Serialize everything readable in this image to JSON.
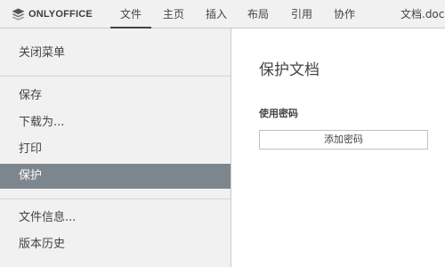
{
  "app": {
    "logo_text": "ONLYOFFICE",
    "logo_icon": "layers-icon",
    "document_title": "文档.docx"
  },
  "tabs": [
    {
      "label": "文件",
      "active": true
    },
    {
      "label": "主页",
      "active": false
    },
    {
      "label": "插入",
      "active": false
    },
    {
      "label": "布局",
      "active": false
    },
    {
      "label": "引用",
      "active": false
    },
    {
      "label": "协作",
      "active": false
    }
  ],
  "menu": {
    "items": [
      {
        "label": "关闭菜单"
      },
      {
        "label": "保存"
      },
      {
        "label": "下载为..."
      },
      {
        "label": "打印"
      },
      {
        "label": "保护",
        "selected": true
      },
      {
        "label": "文件信息..."
      },
      {
        "label": "版本历史"
      }
    ]
  },
  "panel": {
    "title": "保护文档",
    "section_label": "使用密码",
    "add_password_button": "添加密码"
  },
  "colors": {
    "selected_item_bg": "#7e868d",
    "toolbar_bg": "#f1f1f1"
  }
}
